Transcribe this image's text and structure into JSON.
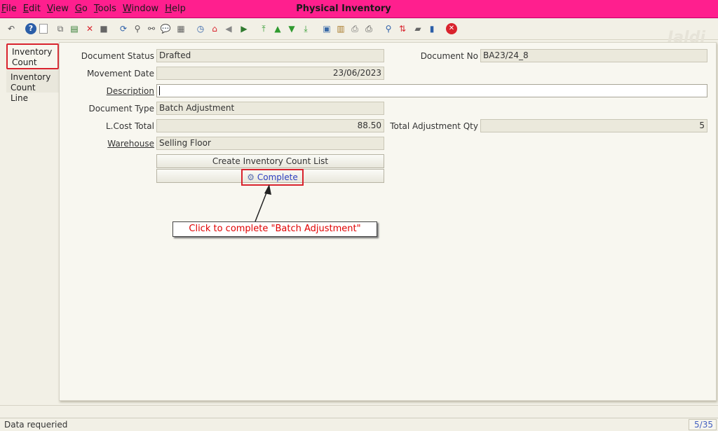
{
  "menu": [
    "File",
    "Edit",
    "View",
    "Go",
    "Tools",
    "Window",
    "Help"
  ],
  "window_title": "Physical Inventory",
  "watermark": "Jaldi",
  "toolbar_icons": [
    {
      "name": "undo-icon",
      "glyph": "↶",
      "color": "#555555"
    },
    {
      "name": "help-icon",
      "glyph": "?",
      "color": "#2b5ea8"
    },
    {
      "name": "new-record-icon",
      "glyph": "",
      "color": "#ffffff"
    },
    {
      "name": "copy-record-icon",
      "glyph": "⧉",
      "color": "#666666"
    },
    {
      "name": "save-record-icon",
      "glyph": "▤",
      "color": "#2f7a2f"
    },
    {
      "name": "delete-icon",
      "glyph": "✕",
      "color": "#d9232d"
    },
    {
      "name": "save-icon",
      "glyph": "■",
      "color": "#666666"
    },
    {
      "name": "refresh-icon",
      "glyph": "⟳",
      "color": "#2b5ea8"
    },
    {
      "name": "find-icon",
      "glyph": "⚲",
      "color": "#555555"
    },
    {
      "name": "attachment-icon",
      "glyph": "⚯",
      "color": "#555555"
    },
    {
      "name": "chat-icon",
      "glyph": "💬",
      "color": "#777777"
    },
    {
      "name": "calendar-icon",
      "glyph": "▦",
      "color": "#666666"
    },
    {
      "name": "history-icon",
      "glyph": "◷",
      "color": "#2b5ea8"
    },
    {
      "name": "home-icon",
      "glyph": "⌂",
      "color": "#d9232d"
    },
    {
      "name": "back-icon",
      "glyph": "◀",
      "color": "#888888"
    },
    {
      "name": "forward-icon",
      "glyph": "▶",
      "color": "#2f7a2f"
    },
    {
      "name": "first-record-icon",
      "glyph": "⤒",
      "color": "#2f9a2f"
    },
    {
      "name": "previous-record-icon",
      "glyph": "▲",
      "color": "#2f9a2f"
    },
    {
      "name": "next-record-icon",
      "glyph": "▼",
      "color": "#2f9a2f"
    },
    {
      "name": "last-record-icon",
      "glyph": "⤓",
      "color": "#2f9a2f"
    },
    {
      "name": "report-icon",
      "glyph": "▣",
      "color": "#3a6aa8"
    },
    {
      "name": "archive-icon",
      "glyph": "▥",
      "color": "#a87a2a"
    },
    {
      "name": "print-preview-icon",
      "glyph": "⎙",
      "color": "#666666"
    },
    {
      "name": "print-icon",
      "glyph": "⎙",
      "color": "#444444"
    },
    {
      "name": "zoom-across-icon",
      "glyph": "⚲",
      "color": "#2b5ea8"
    },
    {
      "name": "workflow-icon",
      "glyph": "⇅",
      "color": "#d9232d"
    },
    {
      "name": "process-icon",
      "glyph": "▰",
      "color": "#666666"
    },
    {
      "name": "product-info-icon",
      "glyph": "▮",
      "color": "#2b5ea8"
    },
    {
      "name": "exit-icon",
      "glyph": "✕",
      "color": "#d9232d"
    }
  ],
  "tabs": {
    "inventory_count": "Inventory Count",
    "inventory_count_line": "Inventory Count Line"
  },
  "form": {
    "document_status": {
      "label": "Document Status",
      "value": "Drafted"
    },
    "document_no": {
      "label": "Document No",
      "value": "BA23/24_8"
    },
    "movement_date": {
      "label": "Movement Date",
      "value": "23/06/2023"
    },
    "description": {
      "label": "Description",
      "value": ""
    },
    "document_type": {
      "label": "Document Type",
      "value": "Batch Adjustment"
    },
    "lcost_total": {
      "label": "L.Cost Total",
      "value": "88.50"
    },
    "total_adjustment_qty": {
      "label": "Total Adjustment Qty",
      "value": "5"
    },
    "warehouse": {
      "label": "Warehouse",
      "value": "Selling Floor"
    }
  },
  "buttons": {
    "create_list": "Create Inventory Count List",
    "complete": "Complete",
    "complete_icon": "⚙"
  },
  "annotation": "Click to complete \"Batch Adjustment\"",
  "status": {
    "message": "Data requeried",
    "record": "5/35"
  },
  "colors": {
    "titlebar": "#ff1f8e",
    "highlight": "#d9232d",
    "annotation_text": "#e00000"
  }
}
